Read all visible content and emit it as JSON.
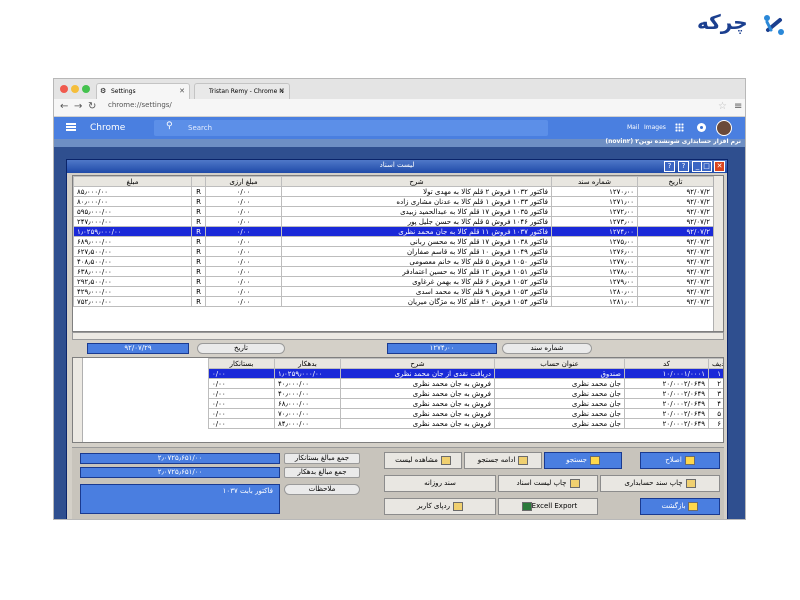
{
  "logo": {
    "text": "چرکه"
  },
  "browser": {
    "tabs": [
      {
        "label": "Settings"
      },
      {
        "label": "Tristan Remy - Chrome N"
      }
    ],
    "url": "chrome://settings/",
    "app_title": "Chrome",
    "search_placeholder": "Search",
    "links": {
      "mail": "Mail",
      "images": "Images"
    }
  },
  "erp": {
    "app_title": "نرم افزار حسابداری شونشده نوین۲ (novin۲)",
    "window_title": "لیست اسناد",
    "documents_table": {
      "columns": [
        "تاریخ",
        "شماره سند",
        "شرح",
        "مبلغ ارزی",
        "",
        "مبلغ"
      ],
      "rows": [
        [
          "۹۲/۰۷/۲",
          "۱۲۷۰٫۰۰",
          "فاکتور ۱۰۳۲ فروش ۲ قلم کالا به مهدی تولا",
          "۰/۰۰",
          "R",
          "۸۵٫۰۰۰/۰۰"
        ],
        [
          "۹۲/۰۷/۲",
          "۱۲۷۱٫۰۰",
          "فاکتور ۱۰۳۳ فروش ۱ قلم کالا به عدنان مشاری زاده",
          "۰/۰۰",
          "R",
          "۸۰٫۰۰۰/۰۰"
        ],
        [
          "۹۲/۰۷/۲",
          "۱۲۷۲٫۰۰",
          "فاکتور ۱۰۳۵ فروش ۱۷ قلم کالا به عبدالحمید زبیدی",
          "۰/۰۰",
          "R",
          "۵۹۵٫۰۰۰/۰۰"
        ],
        [
          "۹۲/۰۷/۲",
          "۱۲۷۳٫۰۰",
          "فاکتور ۱۰۴۶ فروش ۵ قلم کالا به حسن جلیل پور",
          "۰/۰۰",
          "R",
          "۲۴۷٫۰۰۰/۰۰"
        ],
        [
          "۹۲/۰۷/۲",
          "۱۲۷۴٫۰۰",
          "فاکتور ۱۰۳۷ فروش ۱۱ قلم کالا به جان محمد نظری",
          "۰/۰۰",
          "R",
          "۱٫۰۲۵۹٫۰۰۰/۰۰"
        ],
        [
          "۹۲/۰۷/۲",
          "۱۲۷۵٫۰۰",
          "فاکتور ۱۰۳۸ فروش ۱۷ قلم کالا به محسن ربانی",
          "۰/۰۰",
          "R",
          "۶۸۹٫۰۰۰/۰۰"
        ],
        [
          "۹۲/۰۷/۲",
          "۱۲۷۶٫۰۰",
          "فاکتور ۱۰۴۹ فروش ۱۰ قلم کالا به قاسم صفاران",
          "۰/۰۰",
          "R",
          "۶۲۷٫۵۰۰/۰۰"
        ],
        [
          "۹۲/۰۷/۲",
          "۱۲۷۷٫۰۰",
          "فاکتور ۱۰۵۰ فروش ۵ قلم کالا به خانم معصومی",
          "۰/۰۰",
          "R",
          "۴۰۸٫۵۰۰/۰۰"
        ],
        [
          "۹۲/۰۷/۲",
          "۱۲۷۸٫۰۰",
          "فاکتور ۱۰۵۱ فروش ۱۲ قلم کالا به حسین اعتمادفر",
          "۰/۰۰",
          "R",
          "۶۳۸٫۰۰۰/۰۰"
        ],
        [
          "۹۲/۰۷/۲",
          "۱۲۷۹٫۰۰",
          "فاکتور ۱۰۵۲ فروش ۶ قلم کالا به بهمن غرغاوی",
          "۰/۰۰",
          "R",
          "۲۹۲٫۵۰۰/۰۰"
        ],
        [
          "۹۲/۰۷/۲",
          "۱۲۸۰٫۰۰",
          "فاکتور ۱۰۵۳ فروش ۹ قلم کالا به محمد اسدی",
          "۰/۰۰",
          "R",
          "۴۲۹٫۰۰۰/۰۰"
        ],
        [
          "۹۲/۰۷/۲",
          "۱۲۸۱٫۰۰",
          "فاکتور ۱۰۵۴ فروش ۲۰ قلم کالا به مژگان میریان",
          "۰/۰۰",
          "R",
          "۷۵۲٫۰۰۰/۰۰"
        ]
      ],
      "selected_row": 4
    },
    "filter": {
      "doc_number_label": "شماره سند",
      "doc_number_value": "۱۲۷۴٫۰۰",
      "date_label": "تاریخ",
      "date_value": "۹۲/۰۷/۲۹"
    },
    "lines_table": {
      "columns": [
        "ردیف",
        "کد",
        "عنوان حساب",
        "شرح",
        "بدهکار",
        "بستانکار"
      ],
      "rows": [
        [
          "۱",
          "۱۰/۰۰۰۱/۰۰۰۱",
          "صندوق",
          "دریافت نقدی از جان محمد نظری",
          "۱٫۰۲۵۹٫۰۰۰/۰۰",
          "۰/۰۰"
        ],
        [
          "۲",
          "۲۰/۰۰۰۲/۰۶۴۹",
          "جان محمد نظری",
          "فروش به جان محمد نظری",
          "۴۰٫۰۰۰/۰۰",
          "۰/۰۰"
        ],
        [
          "۳",
          "۲۰/۰۰۰۲/۰۶۴۹",
          "جان محمد نظری",
          "فروش به جان محمد نظری",
          "۴۰٫۰۰۰/۰۰",
          "۰/۰۰"
        ],
        [
          "۴",
          "۲۰/۰۰۰۲/۰۶۴۹",
          "جان محمد نظری",
          "فروش به جان محمد نظری",
          "۶۸٫۰۰۰/۰۰",
          "۰/۰۰"
        ],
        [
          "۵",
          "۲۰/۰۰۰۲/۰۶۴۹",
          "جان محمد نظری",
          "فروش به جان محمد نظری",
          "۷۰٫۰۰۰/۰۰",
          "۰/۰۰"
        ],
        [
          "۶",
          "۲۰/۰۰۰۲/۰۶۴۹",
          "جان محمد نظری",
          "فروش به جان محمد نظری",
          "۸۴٫۰۰۰/۰۰",
          "۰/۰۰"
        ]
      ],
      "selected_row": 0
    },
    "totals": {
      "credit_label": "جمع مبالغ بستانکار",
      "credit_value": "۲٫۰۷۲۵٫۶۵۱/۰۰",
      "debit_label": "جمع مبالغ بدهکار",
      "debit_value": "۲٫۰۷۲۵٫۶۵۱/۰۰",
      "notes_label": "ملاحظات",
      "notes_value": "فاکتور بابت ۱۰۳۷"
    },
    "actions": {
      "edit": "اصلاح",
      "search": "جستجو",
      "continue_search": "ادامه جستجو",
      "view_list": "مشاهده لیست",
      "print_voucher": "چاپ سند حسابداری",
      "print_list": "چاپ لیست اسناد",
      "daily_voucher": "سند روزانه",
      "back": "بازگشت",
      "excel_export": "Excell Export",
      "user_trace": "ردپای کاربر"
    }
  }
}
